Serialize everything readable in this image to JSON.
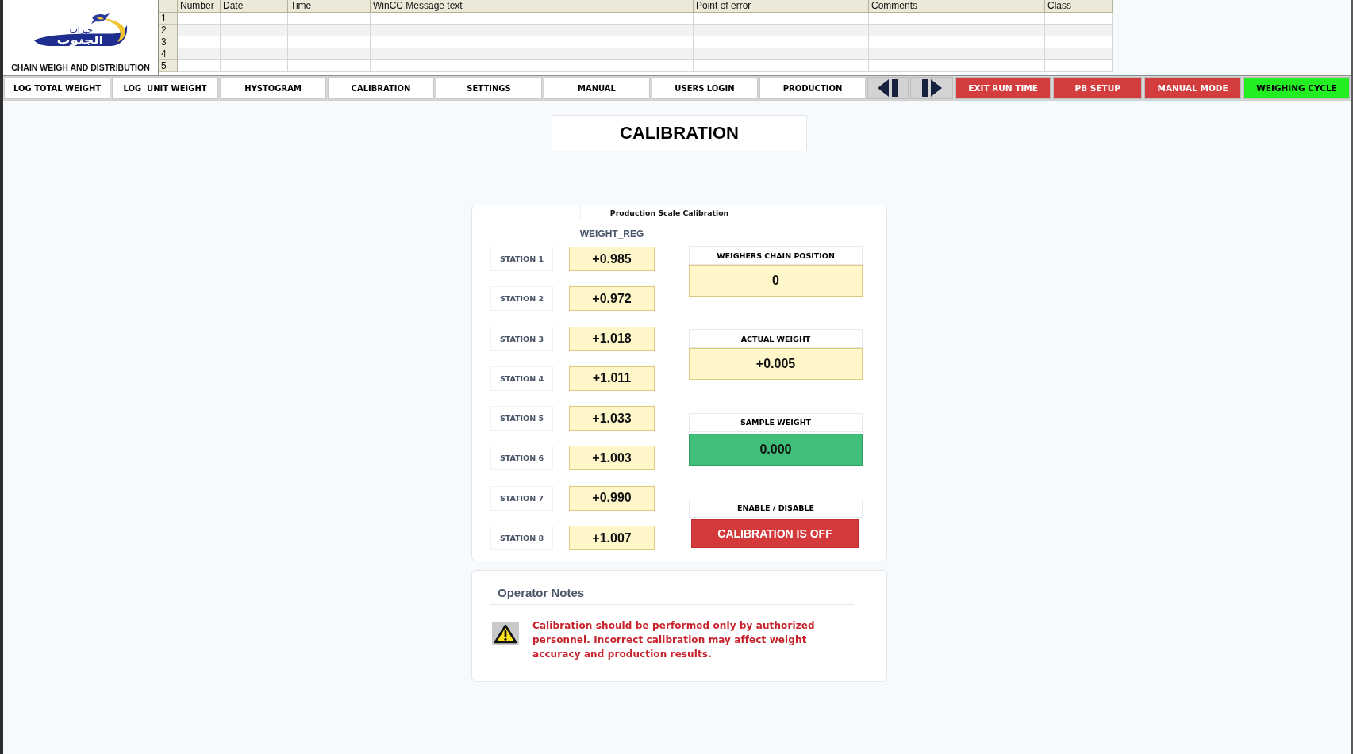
{
  "header": {
    "logo": {
      "upper_text": "خيرات",
      "lower_text": "الجنوب"
    },
    "title": "CHAIN WEIGH AND DISTRIBUTION"
  },
  "alarm_table": {
    "columns": [
      "Number",
      "Date",
      "Time",
      "WinCC Message text",
      "Point of error",
      "Comments",
      "Class"
    ],
    "row_numbers": [
      "1",
      "2",
      "3",
      "4",
      "5"
    ]
  },
  "nav_bar": [
    {
      "kind": "tab",
      "label": "LOG TOTAL WEIGHT"
    },
    {
      "kind": "tab",
      "label": "LOG  UNIT WEIGHT"
    },
    {
      "kind": "tab",
      "label": "HYSTOGRAM"
    },
    {
      "kind": "tab",
      "label": "CALIBRATION"
    },
    {
      "kind": "tab",
      "label": "SETTINGS"
    },
    {
      "kind": "tab",
      "label": "MANUAL"
    },
    {
      "kind": "tab",
      "label": "USERS LOGIN"
    },
    {
      "kind": "tab",
      "label": "PRODUCTION"
    },
    {
      "kind": "previous"
    },
    {
      "kind": "next"
    },
    {
      "kind": "action",
      "label": "EXIT RUN TIME",
      "color": "#d43d3d"
    },
    {
      "kind": "action",
      "label": "PB SETUP",
      "color": "#d43d3d"
    },
    {
      "kind": "action",
      "label": "MANUAL MODE",
      "color": "#d43d3d"
    },
    {
      "kind": "action",
      "label": "WEIGHING CYCLE",
      "color": "#22ee22"
    }
  ],
  "page_title": "CALIBRATION",
  "calibration_panel": {
    "title": "Production Scale Calibration",
    "column_heading": "WEIGHT_REG",
    "stations": [
      {
        "label": "STATION 1",
        "value": "+0.985"
      },
      {
        "label": "STATION 2",
        "value": "+0.972"
      },
      {
        "label": "STATION 3",
        "value": "+1.018"
      },
      {
        "label": "STATION 4",
        "value": "+1.011"
      },
      {
        "label": "STATION 5",
        "value": "+1.033"
      },
      {
        "label": "STATION 6",
        "value": "+1.003"
      },
      {
        "label": "STATION 7",
        "value": "+0.990"
      },
      {
        "label": "STATION 8",
        "value": "+1.007"
      }
    ],
    "readouts": [
      {
        "kind": "display",
        "label": "WEIGHERS CHAIN POSITION",
        "value": "0"
      },
      {
        "kind": "display",
        "label": "ACTUAL WEIGHT",
        "value": "+0.005"
      },
      {
        "kind": "input",
        "label": "SAMPLE WEIGHT",
        "value": "0.000"
      }
    ],
    "calibration_toggle": {
      "label": "ENABLE / DISABLE",
      "button_text": "CALIBRATION IS OFF",
      "on": false
    }
  },
  "operator_notes": {
    "title": "Operator Notes",
    "message": "Calibration should be performed only by authorized personnel. Incorrect calibration may affect weight accuracy and production results."
  }
}
